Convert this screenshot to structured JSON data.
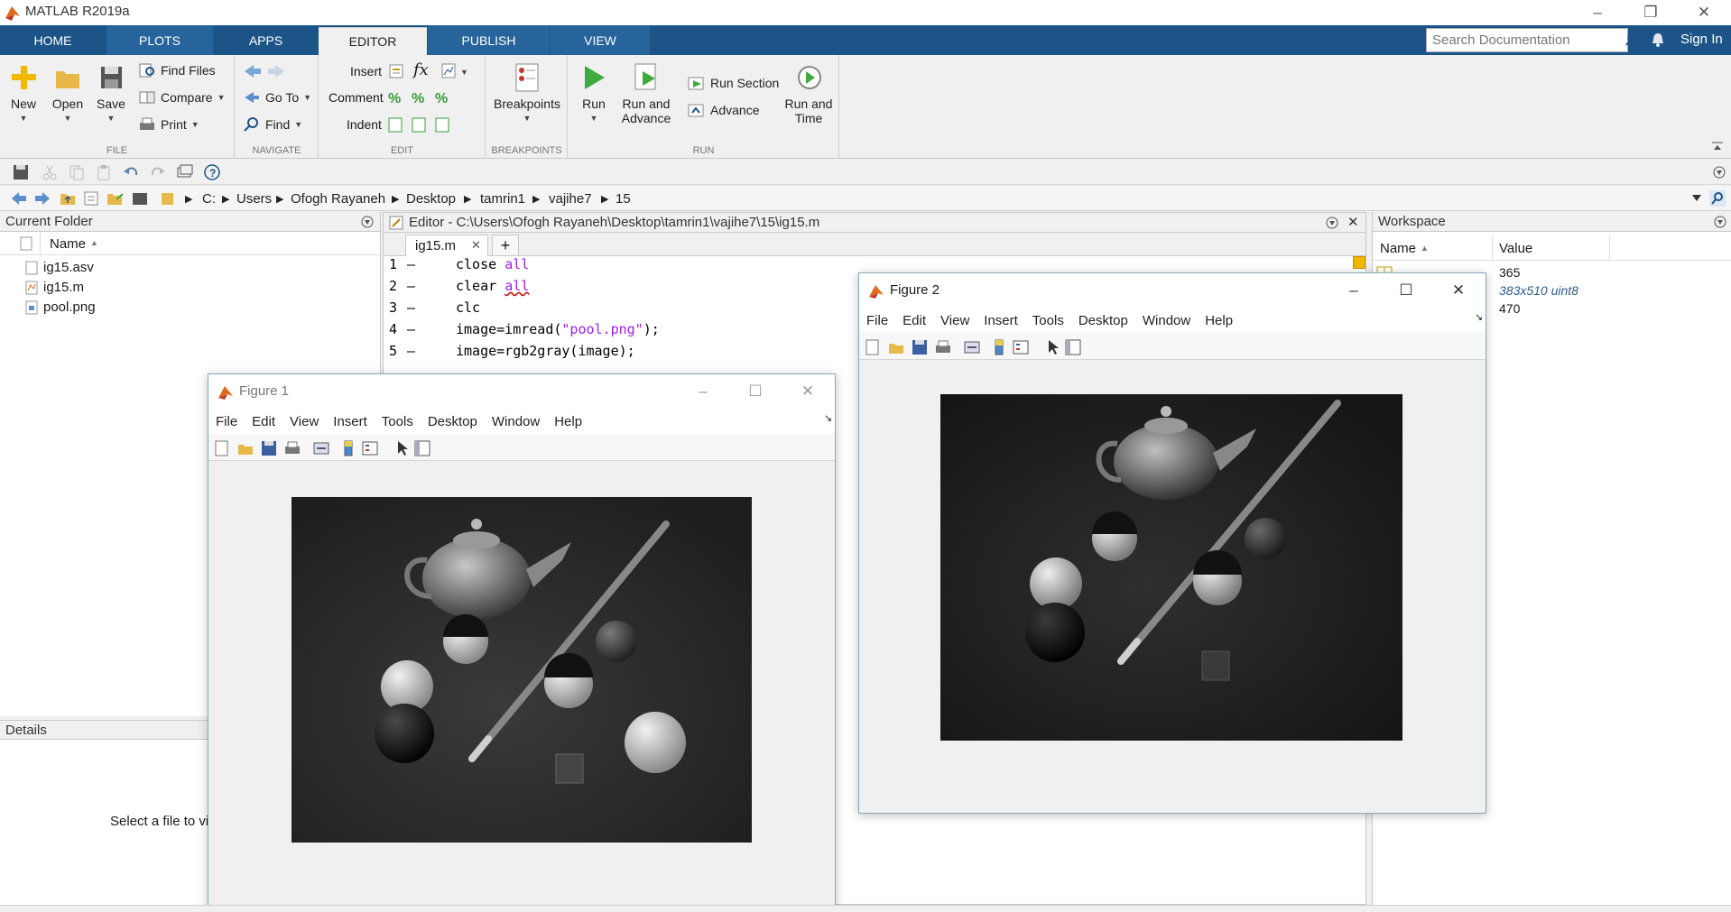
{
  "app": {
    "title": "MATLAB R2019a"
  },
  "tabs": [
    "HOME",
    "PLOTS",
    "APPS",
    "EDITOR",
    "PUBLISH",
    "VIEW"
  ],
  "active_tab": "EDITOR",
  "search": {
    "placeholder": "Search Documentation"
  },
  "sign_in": "Sign In",
  "ribbon": {
    "file": {
      "label": "FILE",
      "new": "New",
      "open": "Open",
      "save": "Save",
      "find_files": "Find Files",
      "compare": "Compare",
      "print": "Print"
    },
    "navigate": {
      "label": "NAVIGATE",
      "go_to": "Go To",
      "find": "Find"
    },
    "edit": {
      "label": "EDIT",
      "insert": "Insert",
      "comment": "Comment",
      "indent": "Indent"
    },
    "breakpoints": {
      "label": "BREAKPOINTS",
      "breakpoints": "Breakpoints"
    },
    "run": {
      "label": "RUN",
      "run": "Run",
      "run_and_advance_1": "Run and",
      "run_and_advance_2": "Advance",
      "run_section": "Run Section",
      "advance": "Advance",
      "run_and_time_1": "Run and",
      "run_and_time_2": "Time"
    }
  },
  "path": [
    "C:",
    "Users",
    "Ofogh Rayaneh",
    "Desktop",
    "tamrin1",
    "vajihe7",
    "15"
  ],
  "current_folder": {
    "title": "Current Folder",
    "column": "Name",
    "files": [
      {
        "name": "ig15.asv",
        "icon": "asv-file-icon"
      },
      {
        "name": "ig15.m",
        "icon": "m-file-icon"
      },
      {
        "name": "pool.png",
        "icon": "image-file-icon"
      }
    ]
  },
  "details": {
    "title": "Details",
    "message": "Select a file to vi"
  },
  "editor": {
    "title": "Editor - C:\\Users\\Ofogh Rayaneh\\Desktop\\tamrin1\\vajihe7\\15\\ig15.m",
    "tab": "ig15.m",
    "lines": [
      {
        "num": "1",
        "dash": "–",
        "pre": "close ",
        "kw": "all",
        "post": ""
      },
      {
        "num": "2",
        "dash": "–",
        "pre": "clear ",
        "kw": "all",
        "post": ""
      },
      {
        "num": "3",
        "dash": "–",
        "pre": "clc",
        "kw": "",
        "post": ""
      },
      {
        "num": "4",
        "dash": "–",
        "pre": "image=imread(",
        "kw": "\"pool.png\"",
        "post": ");"
      },
      {
        "num": "5",
        "dash": "–",
        "pre": "image=rgb2gray(image);",
        "kw": "",
        "post": ""
      }
    ]
  },
  "workspace": {
    "title": "Workspace",
    "col_name": "Name",
    "col_value": "Value",
    "values": [
      "365",
      "383x510 uint8",
      "470"
    ]
  },
  "figure1": {
    "title": "Figure 1",
    "menu": [
      "File",
      "Edit",
      "View",
      "Insert",
      "Tools",
      "Desktop",
      "Window",
      "Help"
    ]
  },
  "figure2": {
    "title": "Figure 2",
    "menu": [
      "File",
      "Edit",
      "View",
      "Insert",
      "Tools",
      "Desktop",
      "Window",
      "Help"
    ]
  },
  "colors": {
    "tab_strip": "#1d5487",
    "ribbon_bg": "#f0f0f0",
    "keyword": "#a020f0"
  }
}
